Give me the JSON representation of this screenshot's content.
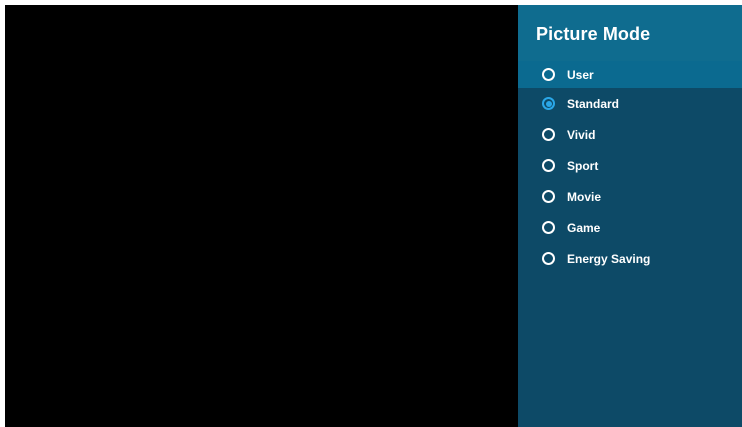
{
  "menu": {
    "title": "Picture Mode",
    "focused_index": 0,
    "selected_index": 1,
    "options": [
      {
        "label": "User"
      },
      {
        "label": "Standard"
      },
      {
        "label": "Vivid"
      },
      {
        "label": "Sport"
      },
      {
        "label": "Movie"
      },
      {
        "label": "Game"
      },
      {
        "label": "Energy Saving"
      }
    ]
  },
  "colors": {
    "panel_background": "#0d4a67",
    "header_background": "#0f6c8f",
    "focus_background": "#0b6a90",
    "radio_selected": "#2aa7e8",
    "video_area": "#000000"
  },
  "icons": {
    "unselected": "radio-unselected-icon",
    "selected": "radio-selected-icon"
  }
}
